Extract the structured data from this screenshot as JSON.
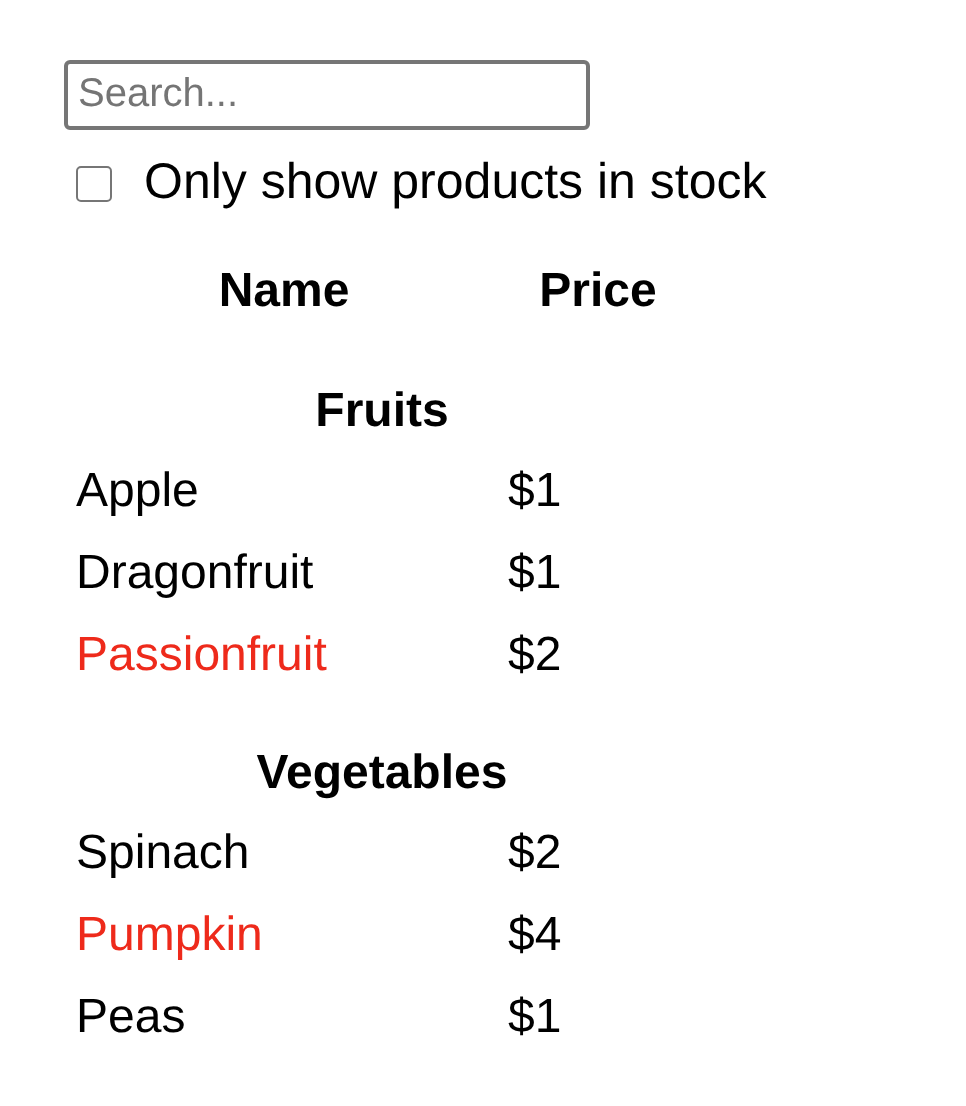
{
  "search": {
    "placeholder": "Search..."
  },
  "stock_filter": {
    "label": "Only show products in stock",
    "checked": false
  },
  "table": {
    "columns": [
      "Name",
      "Price"
    ],
    "categories": [
      {
        "name": "Fruits",
        "products": [
          {
            "name": "Apple",
            "price": "$1",
            "stocked": true
          },
          {
            "name": "Dragonfruit",
            "price": "$1",
            "stocked": true
          },
          {
            "name": "Passionfruit",
            "price": "$2",
            "stocked": false
          }
        ]
      },
      {
        "name": "Vegetables",
        "products": [
          {
            "name": "Spinach",
            "price": "$2",
            "stocked": true
          },
          {
            "name": "Pumpkin",
            "price": "$4",
            "stocked": false
          },
          {
            "name": "Peas",
            "price": "$1",
            "stocked": true
          }
        ]
      }
    ]
  }
}
